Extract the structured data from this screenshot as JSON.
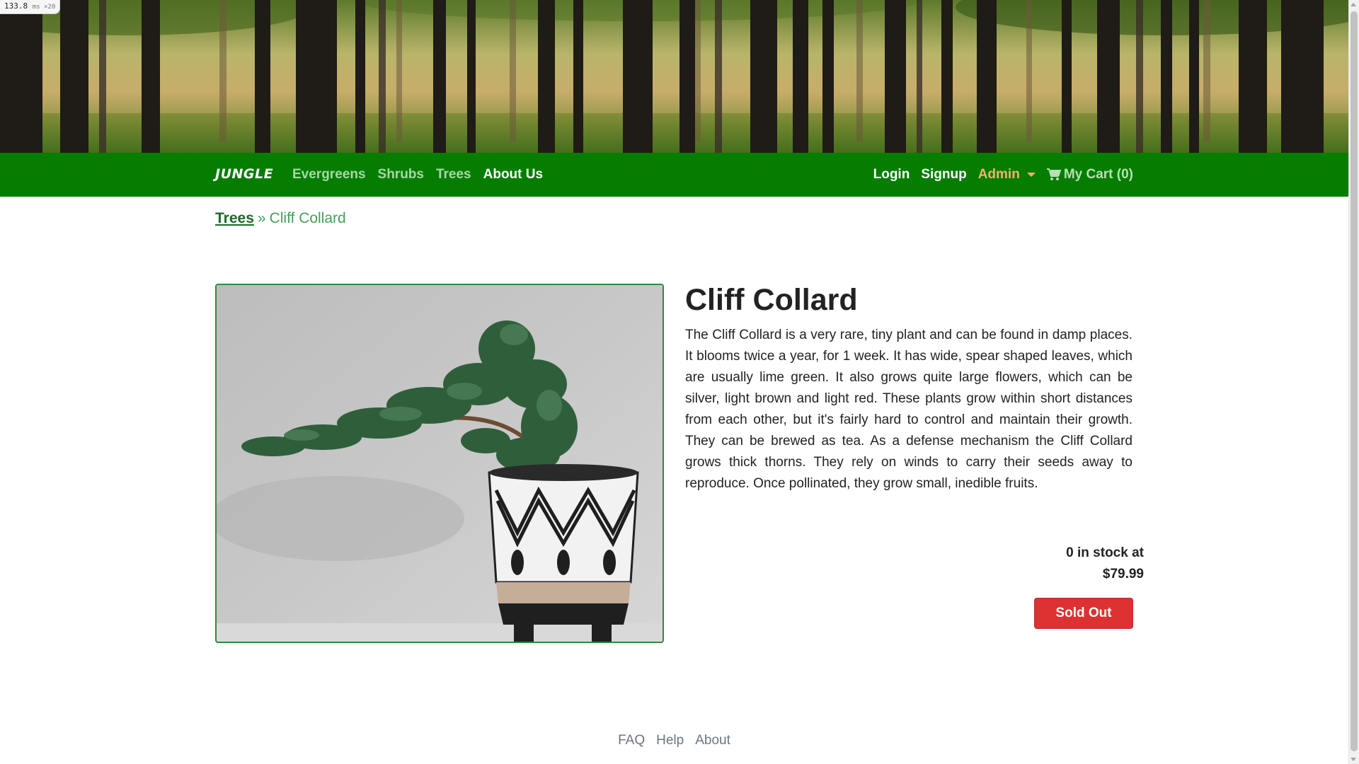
{
  "perf": {
    "value": "133.8",
    "unit": "ms ×20"
  },
  "navbar": {
    "brand": "JUNGLE",
    "links": [
      "Evergreens",
      "Shrubs",
      "Trees",
      "About Us"
    ],
    "login": "Login",
    "signup": "Signup",
    "admin": "Admin",
    "cart": "My Cart (0)"
  },
  "breadcrumb": {
    "category": "Trees",
    "separator": "»",
    "current": "Cliff Collard"
  },
  "product": {
    "name": "Cliff Collard",
    "description": "The Cliff Collard is a very rare, tiny plant and can be found in damp places. It blooms twice a year, for 1 week. It has wide, spear shaped leaves, which are usually lime green. It also grows quite large flowers, which can be silver, light brown and light red. These plants grow within short distances from each other, but it's fairly hard to control and maintain their growth. They can be brewed as tea. As a defense mechanism the Cliff Collard grows thick thorns. They rely on winds to carry their seeds away to reproduce. Once pollinated, they grow small, inedible fruits.",
    "stock": "0 in stock at",
    "price": "$79.99",
    "button": "Sold Out"
  },
  "footer": {
    "links": [
      "FAQ",
      "Help",
      "About"
    ]
  },
  "colors": {
    "navbar": "#047d00",
    "sold_out": "#dc3232",
    "admin": "#f2b26e"
  },
  "icons": {
    "cart": "shopping-cart-icon",
    "admin": "caret-down-icon"
  }
}
